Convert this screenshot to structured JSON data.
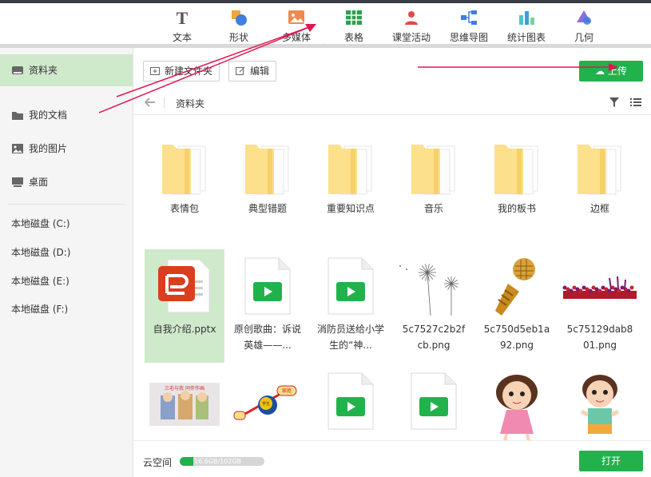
{
  "ribbon": [
    {
      "label": "文本",
      "icon": "text-icon"
    },
    {
      "label": "形状",
      "icon": "shape-icon"
    },
    {
      "label": "多媒体",
      "icon": "multimedia-icon"
    },
    {
      "label": "表格",
      "icon": "table-icon"
    },
    {
      "label": "课堂活动",
      "icon": "classroom-activity-icon"
    },
    {
      "label": "思维导图",
      "icon": "mindmap-icon"
    },
    {
      "label": "统计图表",
      "icon": "chart-icon"
    },
    {
      "label": "几何",
      "icon": "geometry-icon"
    }
  ],
  "sidebar": {
    "items": [
      {
        "label": "资料夹",
        "icon": "drive-icon"
      },
      {
        "label": "我的文档",
        "icon": "folder-icon"
      },
      {
        "label": "我的图片",
        "icon": "image-icon"
      },
      {
        "label": "桌面",
        "icon": "desktop-icon"
      }
    ],
    "disks": [
      "本地磁盘 (C:)",
      "本地磁盘 (D:)",
      "本地磁盘 (E:)",
      "本地磁盘 (F:)"
    ]
  },
  "toolbar": {
    "new_folder": "新建文件夹",
    "edit": "编辑",
    "upload": "上传"
  },
  "breadcrumb": {
    "current": "资料夹"
  },
  "folders": [
    "表情包",
    "典型错题",
    "重要知识点",
    "音乐",
    "我的板书",
    "边框"
  ],
  "files": [
    {
      "name": "自我介绍.pptx",
      "type": "pptx",
      "selected": true
    },
    {
      "name": "原创歌曲：诉说英雄——...",
      "type": "video"
    },
    {
      "name": "消防员送给小学生的“神...",
      "type": "video"
    },
    {
      "name": "5c7527c2b2fcb.png",
      "type": "dandelion"
    },
    {
      "name": "5c750d5eb1a92.png",
      "type": "microphone"
    },
    {
      "name": "5c75129dab801.png",
      "type": "crowd"
    }
  ],
  "files_row3": [
    {
      "type": "cartoon"
    },
    {
      "type": "diagram"
    },
    {
      "type": "video"
    },
    {
      "type": "video"
    },
    {
      "type": "girl"
    },
    {
      "type": "boy"
    }
  ],
  "thumb_text": {
    "cartoon_caption": "三毛与我 同伴作画",
    "diagram_left": "家庭",
    "diagram_mid": "学生"
  },
  "footer": {
    "cloud_label": "云空间",
    "storage": "16.6GB/102GB",
    "used_fraction": 0.163,
    "open": "打开"
  },
  "colors": {
    "accent": "#22b24c",
    "selected": "#cfeacb",
    "arrow": "#e0174f"
  }
}
